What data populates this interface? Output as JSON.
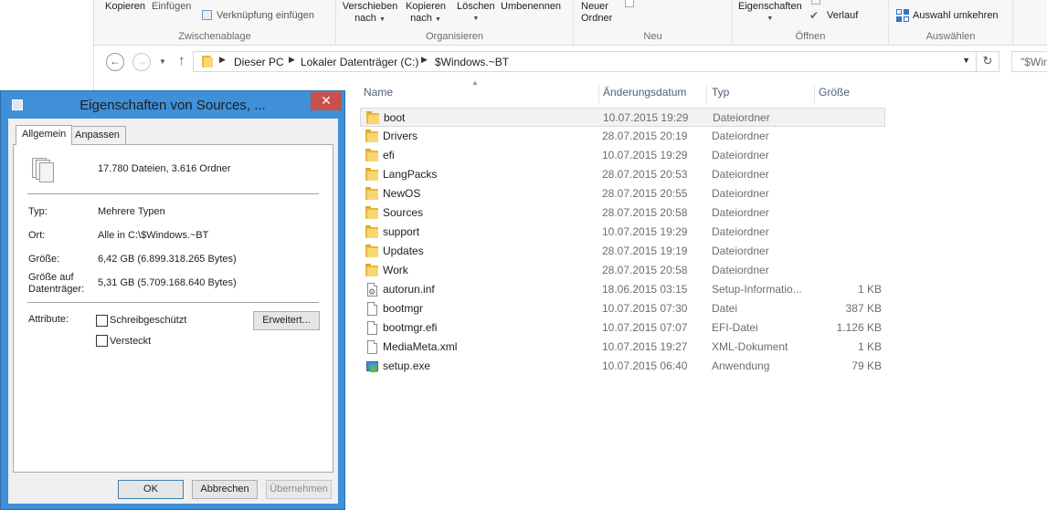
{
  "ribbon": {
    "clipboard": {
      "copy_label": "Kopieren",
      "paste_label": "Einfügen",
      "paste_shortcut_label": "Verknüpfung einfügen",
      "group_label": "Zwischenablage"
    },
    "organize": {
      "move_label_1": "Verschieben",
      "move_label_2": "nach",
      "copy_to_label_1": "Kopieren",
      "copy_to_label_2": "nach",
      "delete_label": "Löschen",
      "rename_label": "Umbenennen",
      "group_label": "Organisieren"
    },
    "new": {
      "new_folder_label_1": "Neuer",
      "new_folder_label_2": "Ordner",
      "group_label": "Neu"
    },
    "open": {
      "properties_label": "Eigenschaften",
      "history_label": "Verlauf",
      "group_label": "Öffnen"
    },
    "select": {
      "invert_label": "Auswahl umkehren",
      "group_label": "Auswählen"
    }
  },
  "address": {
    "crumbs": [
      "Dieser PC",
      "Lokaler Datenträger (C:)",
      "$Windows.~BT"
    ],
    "search_placeholder": "\"$Win"
  },
  "columns": {
    "name": "Name",
    "date": "Änderungsdatum",
    "type": "Typ",
    "size": "Größe"
  },
  "files": [
    {
      "name": "boot",
      "date": "10.07.2015 19:29",
      "type": "Dateiordner",
      "size": "",
      "icon": "folder-icon"
    },
    {
      "name": "Drivers",
      "date": "28.07.2015 20:19",
      "type": "Dateiordner",
      "size": "",
      "icon": "folder-icon"
    },
    {
      "name": "efi",
      "date": "10.07.2015 19:29",
      "type": "Dateiordner",
      "size": "",
      "icon": "folder-icon"
    },
    {
      "name": "LangPacks",
      "date": "28.07.2015 20:53",
      "type": "Dateiordner",
      "size": "",
      "icon": "folder-icon"
    },
    {
      "name": "NewOS",
      "date": "28.07.2015 20:55",
      "type": "Dateiordner",
      "size": "",
      "icon": "folder-icon"
    },
    {
      "name": "Sources",
      "date": "28.07.2015 20:58",
      "type": "Dateiordner",
      "size": "",
      "icon": "folder-icon"
    },
    {
      "name": "support",
      "date": "10.07.2015 19:29",
      "type": "Dateiordner",
      "size": "",
      "icon": "folder-icon"
    },
    {
      "name": "Updates",
      "date": "28.07.2015 19:19",
      "type": "Dateiordner",
      "size": "",
      "icon": "folder-icon"
    },
    {
      "name": "Work",
      "date": "28.07.2015 20:58",
      "type": "Dateiordner",
      "size": "",
      "icon": "folder-icon"
    },
    {
      "name": "autorun.inf",
      "date": "18.06.2015 03:15",
      "type": "Setup-Informatio...",
      "size": "1 KB",
      "icon": "settings-file-icon"
    },
    {
      "name": "bootmgr",
      "date": "10.07.2015 07:30",
      "type": "Datei",
      "size": "387 KB",
      "icon": "file-icon"
    },
    {
      "name": "bootmgr.efi",
      "date": "10.07.2015 07:07",
      "type": "EFI-Datei",
      "size": "1.126 KB",
      "icon": "file-icon"
    },
    {
      "name": "MediaMeta.xml",
      "date": "10.07.2015 19:27",
      "type": "XML-Dokument",
      "size": "1 KB",
      "icon": "xml-file-icon"
    },
    {
      "name": "setup.exe",
      "date": "10.07.2015 06:40",
      "type": "Anwendung",
      "size": "79 KB",
      "icon": "setup-exe-icon"
    }
  ],
  "dialog": {
    "title": "Eigenschaften von Sources, ...",
    "close_symbol": "✕",
    "tabs": [
      "Allgemein",
      "Anpassen"
    ],
    "summary": "17.780 Dateien, 3.616 Ordner",
    "type_label": "Typ:",
    "type_value": "Mehrere Typen",
    "location_label": "Ort:",
    "location_value": "Alle in C:\\$Windows.~BT",
    "size_label": "Größe:",
    "size_value": "6,42 GB (6.899.318.265 Bytes)",
    "disk_size_label_1": "Größe auf",
    "disk_size_label_2": "Datenträger:",
    "disk_size_value": "5,31 GB (5.709.168.640 Bytes)",
    "attributes_label": "Attribute:",
    "readonly_label": "Schreibgeschützt",
    "hidden_label": "Versteckt",
    "advanced_label": "Erweitert...",
    "ok_label": "OK",
    "cancel_label": "Abbrechen",
    "apply_label": "Übernehmen"
  }
}
